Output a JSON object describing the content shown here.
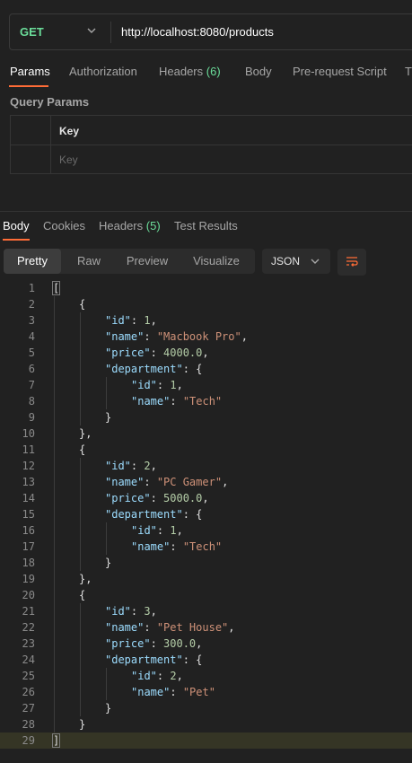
{
  "request": {
    "method": "GET",
    "url": "http://localhost:8080/products"
  },
  "request_tabs": [
    {
      "label": "Params",
      "active": true
    },
    {
      "label": "Authorization"
    },
    {
      "label": "Headers",
      "count": "(6)"
    },
    {
      "label": "Body"
    },
    {
      "label": "Pre-request Script"
    },
    {
      "label": "T"
    }
  ],
  "query_params": {
    "title": "Query Params",
    "key_header": "Key",
    "key_placeholder": "Key"
  },
  "response_tabs": [
    {
      "label": "Body",
      "active": true
    },
    {
      "label": "Cookies"
    },
    {
      "label": "Headers",
      "count": "(5)"
    },
    {
      "label": "Test Results"
    }
  ],
  "view_modes": [
    {
      "label": "Pretty",
      "active": true
    },
    {
      "label": "Raw"
    },
    {
      "label": "Preview"
    },
    {
      "label": "Visualize"
    }
  ],
  "format": "JSON",
  "icons": {
    "method_dropdown": "chevron-down-icon",
    "format_dropdown": "chevron-down-icon",
    "wrap": "wrap-lines-icon"
  },
  "colors": {
    "accent": "#ff6c37",
    "method": "#6bdd9a",
    "count": "#6bdd9a",
    "json_key": "#9cdcfe",
    "json_string": "#ce9178",
    "json_number": "#b5cea8"
  },
  "code_lines": [
    {
      "n": "1",
      "indent": 0,
      "tokens": [
        [
          "p",
          "["
        ]
      ]
    },
    {
      "n": "2",
      "indent": 1,
      "tokens": [
        [
          "p",
          "{"
        ]
      ]
    },
    {
      "n": "3",
      "indent": 2,
      "tokens": [
        [
          "k",
          "\"id\""
        ],
        [
          "p",
          ": "
        ],
        [
          "n",
          "1"
        ],
        [
          "p",
          ","
        ]
      ]
    },
    {
      "n": "4",
      "indent": 2,
      "tokens": [
        [
          "k",
          "\"name\""
        ],
        [
          "p",
          ": "
        ],
        [
          "s",
          "\"Macbook Pro\""
        ],
        [
          "p",
          ","
        ]
      ]
    },
    {
      "n": "5",
      "indent": 2,
      "tokens": [
        [
          "k",
          "\"price\""
        ],
        [
          "p",
          ": "
        ],
        [
          "n",
          "4000.0"
        ],
        [
          "p",
          ","
        ]
      ]
    },
    {
      "n": "6",
      "indent": 2,
      "tokens": [
        [
          "k",
          "\"department\""
        ],
        [
          "p",
          ": {"
        ]
      ]
    },
    {
      "n": "7",
      "indent": 3,
      "tokens": [
        [
          "k",
          "\"id\""
        ],
        [
          "p",
          ": "
        ],
        [
          "n",
          "1"
        ],
        [
          "p",
          ","
        ]
      ]
    },
    {
      "n": "8",
      "indent": 3,
      "tokens": [
        [
          "k",
          "\"name\""
        ],
        [
          "p",
          ": "
        ],
        [
          "s",
          "\"Tech\""
        ]
      ]
    },
    {
      "n": "9",
      "indent": 2,
      "tokens": [
        [
          "p",
          "}"
        ]
      ]
    },
    {
      "n": "10",
      "indent": 1,
      "tokens": [
        [
          "p",
          "},"
        ]
      ]
    },
    {
      "n": "11",
      "indent": 1,
      "tokens": [
        [
          "p",
          "{"
        ]
      ]
    },
    {
      "n": "12",
      "indent": 2,
      "tokens": [
        [
          "k",
          "\"id\""
        ],
        [
          "p",
          ": "
        ],
        [
          "n",
          "2"
        ],
        [
          "p",
          ","
        ]
      ]
    },
    {
      "n": "13",
      "indent": 2,
      "tokens": [
        [
          "k",
          "\"name\""
        ],
        [
          "p",
          ": "
        ],
        [
          "s",
          "\"PC Gamer\""
        ],
        [
          "p",
          ","
        ]
      ]
    },
    {
      "n": "14",
      "indent": 2,
      "tokens": [
        [
          "k",
          "\"price\""
        ],
        [
          "p",
          ": "
        ],
        [
          "n",
          "5000.0"
        ],
        [
          "p",
          ","
        ]
      ]
    },
    {
      "n": "15",
      "indent": 2,
      "tokens": [
        [
          "k",
          "\"department\""
        ],
        [
          "p",
          ": {"
        ]
      ]
    },
    {
      "n": "16",
      "indent": 3,
      "tokens": [
        [
          "k",
          "\"id\""
        ],
        [
          "p",
          ": "
        ],
        [
          "n",
          "1"
        ],
        [
          "p",
          ","
        ]
      ]
    },
    {
      "n": "17",
      "indent": 3,
      "tokens": [
        [
          "k",
          "\"name\""
        ],
        [
          "p",
          ": "
        ],
        [
          "s",
          "\"Tech\""
        ]
      ]
    },
    {
      "n": "18",
      "indent": 2,
      "tokens": [
        [
          "p",
          "}"
        ]
      ]
    },
    {
      "n": "19",
      "indent": 1,
      "tokens": [
        [
          "p",
          "},"
        ]
      ]
    },
    {
      "n": "20",
      "indent": 1,
      "tokens": [
        [
          "p",
          "{"
        ]
      ]
    },
    {
      "n": "21",
      "indent": 2,
      "tokens": [
        [
          "k",
          "\"id\""
        ],
        [
          "p",
          ": "
        ],
        [
          "n",
          "3"
        ],
        [
          "p",
          ","
        ]
      ]
    },
    {
      "n": "22",
      "indent": 2,
      "tokens": [
        [
          "k",
          "\"name\""
        ],
        [
          "p",
          ": "
        ],
        [
          "s",
          "\"Pet House\""
        ],
        [
          "p",
          ","
        ]
      ]
    },
    {
      "n": "23",
      "indent": 2,
      "tokens": [
        [
          "k",
          "\"price\""
        ],
        [
          "p",
          ": "
        ],
        [
          "n",
          "300.0"
        ],
        [
          "p",
          ","
        ]
      ]
    },
    {
      "n": "24",
      "indent": 2,
      "tokens": [
        [
          "k",
          "\"department\""
        ],
        [
          "p",
          ": {"
        ]
      ]
    },
    {
      "n": "25",
      "indent": 3,
      "tokens": [
        [
          "k",
          "\"id\""
        ],
        [
          "p",
          ": "
        ],
        [
          "n",
          "2"
        ],
        [
          "p",
          ","
        ]
      ]
    },
    {
      "n": "26",
      "indent": 3,
      "tokens": [
        [
          "k",
          "\"name\""
        ],
        [
          "p",
          ": "
        ],
        [
          "s",
          "\"Pet\""
        ]
      ]
    },
    {
      "n": "27",
      "indent": 2,
      "tokens": [
        [
          "p",
          "}"
        ]
      ]
    },
    {
      "n": "28",
      "indent": 1,
      "tokens": [
        [
          "p",
          "}"
        ]
      ]
    },
    {
      "n": "29",
      "indent": 0,
      "tokens": [
        [
          "p",
          "]"
        ]
      ],
      "highlight": true
    }
  ]
}
